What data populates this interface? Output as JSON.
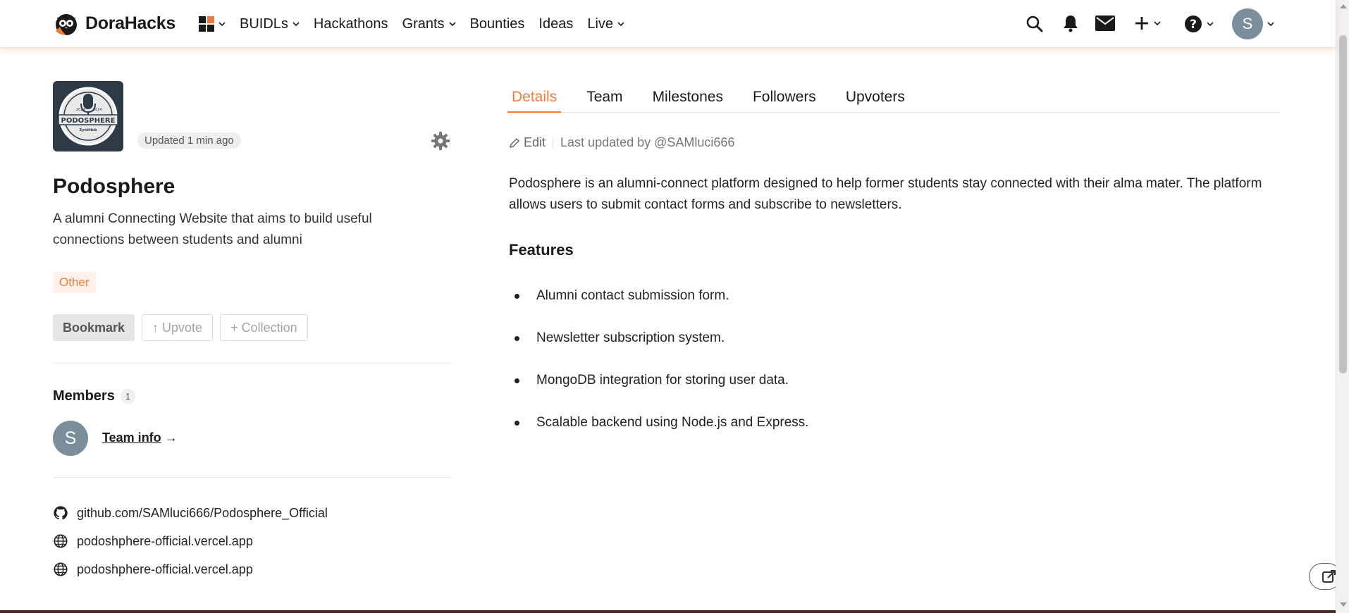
{
  "brand": {
    "name": "DoraHacks"
  },
  "nav": {
    "items": [
      {
        "label": "BUIDLs",
        "dropdown": true
      },
      {
        "label": "Hackathons",
        "dropdown": false
      },
      {
        "label": "Grants",
        "dropdown": true
      },
      {
        "label": "Bounties",
        "dropdown": false
      },
      {
        "label": "Ideas",
        "dropdown": false
      },
      {
        "label": "Live",
        "dropdown": true
      }
    ],
    "user_initial": "S"
  },
  "project": {
    "logo_text": "PODOSPHERE",
    "logo_subtext": "ZynkHub",
    "logo_year_left": "2024",
    "logo_year_right": "2024",
    "updated": "Updated 1 min ago",
    "title": "Podosphere",
    "description": "A alumni Connecting Website that aims to build useful connections between students and alumni",
    "tag": "Other",
    "buttons": {
      "bookmark": "Bookmark",
      "upvote": "↑ Upvote",
      "collection": "+ Collection"
    }
  },
  "members": {
    "title": "Members",
    "count": "1",
    "avatar_initial": "S",
    "team_link": "Team info",
    "team_arrow": "→"
  },
  "links": [
    {
      "icon": "github-icon",
      "text": "github.com/SAMluci666/Podosphere_Official"
    },
    {
      "icon": "globe-icon",
      "text": "podoshphere-official.vercel.app"
    },
    {
      "icon": "globe-icon",
      "text": "podoshphere-official.vercel.app"
    }
  ],
  "tabs": [
    "Details",
    "Team",
    "Milestones",
    "Followers",
    "Upvoters"
  ],
  "details": {
    "edit_label": "Edit",
    "last_updated": "Last updated by @SAMluci666",
    "intro": "Podosphere is an alumni-connect platform designed to help former students stay connected with their alma mater. The platform allows users to submit contact forms and subscribe to newsletters.",
    "features_heading": "Features",
    "features": [
      "Alumni contact submission form.",
      "Newsletter subscription system.",
      "MongoDB integration for storing user data.",
      "Scalable backend using Node.js and Express."
    ]
  },
  "colors": {
    "accent": "#f07a3b",
    "text": "#1f1f1f",
    "avatar": "#7a8e9c"
  }
}
